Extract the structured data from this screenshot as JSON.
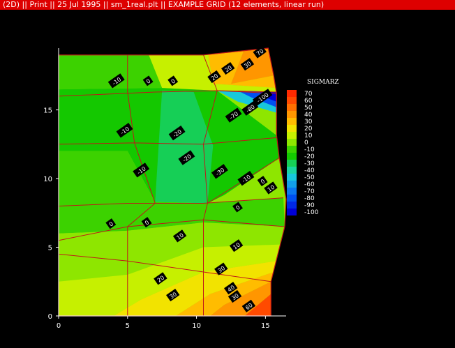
{
  "window": {
    "title": "(2D) || Print || 25 Jul 1995 || sm_1real.plt || EXAMPLE GRID (12 elements, linear run)"
  },
  "chart_data": {
    "type": "contour",
    "field": "SIGMARZ",
    "xlim": [
      0,
      16.5
    ],
    "ylim": [
      0,
      19.5
    ],
    "x_ticks": [
      "0",
      "5",
      "10",
      "15"
    ],
    "y_ticks": [
      "0",
      "5",
      "10",
      "15"
    ],
    "legend": {
      "title": "SIGMARZ",
      "levels": [
        70,
        60,
        50,
        40,
        30,
        20,
        10,
        0,
        -10,
        -20,
        -30,
        -40,
        -50,
        -60,
        -70,
        -80,
        -90,
        -100
      ],
      "colors": [
        "#ff2a00",
        "#ff4a00",
        "#ff7000",
        "#ff9600",
        "#ffbc00",
        "#f2e300",
        "#c6f000",
        "#8ee600",
        "#3cd200",
        "#14c800",
        "#16cf56",
        "#1ad6a0",
        "#18c8dc",
        "#12a0e8",
        "#0a78f0",
        "#0050f0",
        "#0028e8",
        "#0000d8"
      ]
    },
    "domain_outline": [
      [
        0,
        0
      ],
      [
        15.4,
        0
      ],
      [
        15.4,
        2.5
      ],
      [
        16.4,
        6.5
      ],
      [
        16.5,
        8.5
      ],
      [
        16.0,
        11.5
      ],
      [
        15.8,
        13.2
      ],
      [
        15.8,
        16.2
      ],
      [
        15.6,
        17.5
      ],
      [
        15.2,
        19.5
      ],
      [
        10.5,
        19.0
      ],
      [
        0,
        19.0
      ]
    ],
    "mesh_lines": [
      [
        [
          0,
          19.0
        ],
        [
          10.5,
          19.0
        ],
        [
          15.2,
          19.5
        ]
      ],
      [
        [
          0,
          16.0
        ],
        [
          7,
          16.3
        ],
        [
          11.5,
          16.4
        ],
        [
          15.8,
          16.3
        ]
      ],
      [
        [
          0,
          12.5
        ],
        [
          5.5,
          12.6
        ],
        [
          10.5,
          12.5
        ],
        [
          16.0,
          13.0
        ]
      ],
      [
        [
          0,
          8.0
        ],
        [
          5,
          8.2
        ],
        [
          10.5,
          8.2
        ],
        [
          16.3,
          8.6
        ]
      ],
      [
        [
          0,
          5.5
        ],
        [
          5,
          6.5
        ],
        [
          10.5,
          7.0
        ],
        [
          16.4,
          6.5
        ]
      ],
      [
        [
          0,
          4.5
        ],
        [
          5,
          4.0
        ],
        [
          10.5,
          3.2
        ],
        [
          15.4,
          2.5
        ]
      ],
      [
        [
          5,
          19.0
        ],
        [
          5,
          16.3
        ],
        [
          5.5,
          12.6
        ],
        [
          7,
          8.2
        ],
        [
          5,
          6.5
        ],
        [
          5,
          4.0
        ],
        [
          5,
          0
        ]
      ],
      [
        [
          10.5,
          19.0
        ],
        [
          11.5,
          16.4
        ],
        [
          10.5,
          12.5
        ],
        [
          10.8,
          8.2
        ],
        [
          10.5,
          7.0
        ],
        [
          10.5,
          3.2
        ],
        [
          10.5,
          0
        ]
      ],
      [
        [
          11.5,
          16.4
        ],
        [
          15.8,
          16.2
        ]
      ],
      [
        [
          10.8,
          8.2
        ],
        [
          16.0,
          11.5
        ]
      ]
    ],
    "zones": [
      {
        "level": 40,
        "polygon": [
          [
            13.5,
            19.5
          ],
          [
            15.2,
            19.5
          ],
          [
            15.6,
            17.5
          ],
          [
            12.5,
            16.9
          ]
        ]
      },
      {
        "level": 30,
        "polygon": [
          [
            10.8,
            19.3
          ],
          [
            13.5,
            19.5
          ],
          [
            12.5,
            16.9
          ],
          [
            15.6,
            17.5
          ],
          [
            15.8,
            16.6
          ],
          [
            11.2,
            16.9
          ]
        ]
      },
      {
        "level": 10,
        "polygon": [
          [
            6.5,
            19.1
          ],
          [
            10.8,
            19.3
          ],
          [
            11.2,
            16.9
          ],
          [
            15.8,
            16.6
          ],
          [
            15.8,
            16.2
          ],
          [
            7.5,
            16.6
          ]
        ]
      },
      {
        "level": -50,
        "polygon": [
          [
            11.5,
            16.4
          ],
          [
            15.8,
            16.3
          ],
          [
            15.8,
            14.8
          ],
          [
            13.0,
            15.6
          ]
        ]
      },
      {
        "level": -80,
        "polygon": [
          [
            13.0,
            16.4
          ],
          [
            15.8,
            16.3
          ],
          [
            15.8,
            15.2
          ],
          [
            14.0,
            15.9
          ]
        ]
      },
      {
        "level": -100,
        "polygon": [
          [
            14.6,
            16.3
          ],
          [
            15.8,
            16.3
          ],
          [
            15.8,
            15.6
          ],
          [
            15.0,
            15.9
          ]
        ]
      },
      {
        "level": -10,
        "polygon": [
          [
            0,
            19.0
          ],
          [
            6.5,
            19.1
          ],
          [
            7.5,
            16.6
          ],
          [
            0,
            16.5
          ]
        ]
      },
      {
        "level": -20,
        "polygon": [
          [
            0,
            16.5
          ],
          [
            7.5,
            16.6
          ],
          [
            11.5,
            16.4
          ],
          [
            16.0,
            13.0
          ],
          [
            16.0,
            11.5
          ],
          [
            12.0,
            8.8
          ],
          [
            7.0,
            8.3
          ],
          [
            5.0,
            12.0
          ],
          [
            0,
            12.0
          ]
        ]
      },
      {
        "level": -30,
        "polygon": [
          [
            7.0,
            8.3
          ],
          [
            10.8,
            8.2
          ],
          [
            12.0,
            8.8
          ],
          [
            11.2,
            12.4
          ],
          [
            9.8,
            16.3
          ],
          [
            7.5,
            16.4
          ]
        ]
      },
      {
        "level": -20,
        "polygon": [
          [
            10.8,
            8.2
          ],
          [
            12.0,
            8.8
          ],
          [
            16.0,
            11.5
          ],
          [
            16.0,
            13.0
          ],
          [
            12.5,
            12.6
          ],
          [
            11.2,
            12.4
          ]
        ]
      },
      {
        "level": -10,
        "polygon": [
          [
            0,
            12.0
          ],
          [
            5.0,
            12.0
          ],
          [
            7.0,
            8.3
          ],
          [
            10.8,
            8.2
          ],
          [
            16.3,
            8.6
          ],
          [
            16.4,
            6.5
          ],
          [
            10.5,
            6.8
          ],
          [
            5.0,
            6.2
          ],
          [
            0,
            6.0
          ]
        ]
      },
      {
        "level": 0,
        "polygon": [
          [
            0,
            6.0
          ],
          [
            5.0,
            6.2
          ],
          [
            10.5,
            6.8
          ],
          [
            16.4,
            6.5
          ],
          [
            16.1,
            5.2
          ],
          [
            10.5,
            5.0
          ],
          [
            5.0,
            3.0
          ],
          [
            0,
            2.5
          ]
        ]
      },
      {
        "level": 10,
        "polygon": [
          [
            0,
            2.5
          ],
          [
            5.0,
            3.0
          ],
          [
            10.5,
            5.0
          ],
          [
            16.1,
            5.2
          ],
          [
            15.8,
            4.0
          ],
          [
            10.5,
            3.2
          ],
          [
            6.0,
            1.2
          ],
          [
            4.0,
            0
          ],
          [
            0,
            0
          ]
        ]
      },
      {
        "level": 20,
        "polygon": [
          [
            4.0,
            0
          ],
          [
            6.0,
            1.2
          ],
          [
            10.5,
            3.2
          ],
          [
            15.8,
            4.0
          ],
          [
            15.6,
            3.2
          ],
          [
            11.0,
            1.6
          ],
          [
            8.5,
            0
          ]
        ]
      },
      {
        "level": 30,
        "polygon": [
          [
            8.5,
            0
          ],
          [
            11.0,
            1.6
          ],
          [
            15.6,
            3.2
          ],
          [
            15.4,
            2.5
          ],
          [
            12.0,
            0.8
          ],
          [
            11.0,
            0
          ]
        ]
      },
      {
        "level": 40,
        "polygon": [
          [
            11.0,
            0
          ],
          [
            12.0,
            0.8
          ],
          [
            15.4,
            2.5
          ],
          [
            15.4,
            1.6
          ],
          [
            13.5,
            0
          ]
        ]
      },
      {
        "level": 60,
        "polygon": [
          [
            13.5,
            0
          ],
          [
            15.4,
            1.6
          ],
          [
            15.4,
            0
          ]
        ]
      }
    ],
    "contour_labels": [
      {
        "text": "70",
        "x": 14.6,
        "y": 19.2
      },
      {
        "text": "30",
        "x": 13.7,
        "y": 18.3
      },
      {
        "text": "20",
        "x": 12.3,
        "y": 18.0
      },
      {
        "text": "20",
        "x": 11.3,
        "y": 17.4
      },
      {
        "text": "-10",
        "x": 4.2,
        "y": 17.1
      },
      {
        "text": "0",
        "x": 6.5,
        "y": 17.1
      },
      {
        "text": "0",
        "x": 8.3,
        "y": 17.1
      },
      {
        "text": "-100",
        "x": 14.8,
        "y": 15.9
      },
      {
        "text": "-80",
        "x": 13.9,
        "y": 15.1
      },
      {
        "text": "-70",
        "x": 12.7,
        "y": 14.6
      },
      {
        "text": "-10",
        "x": 4.8,
        "y": 13.5
      },
      {
        "text": "-20",
        "x": 8.6,
        "y": 13.3
      },
      {
        "text": "-20",
        "x": 9.3,
        "y": 11.5
      },
      {
        "text": "-10",
        "x": 6.0,
        "y": 10.6
      },
      {
        "text": "-30",
        "x": 11.7,
        "y": 10.5
      },
      {
        "text": "-10",
        "x": 13.6,
        "y": 10.0
      },
      {
        "text": "0",
        "x": 14.8,
        "y": 9.8
      },
      {
        "text": "10",
        "x": 15.4,
        "y": 9.3
      },
      {
        "text": "0",
        "x": 13.0,
        "y": 7.9
      },
      {
        "text": "0",
        "x": 3.8,
        "y": 6.7
      },
      {
        "text": "0",
        "x": 6.4,
        "y": 6.8
      },
      {
        "text": "10",
        "x": 8.8,
        "y": 5.8
      },
      {
        "text": "10",
        "x": 12.9,
        "y": 5.1
      },
      {
        "text": "30",
        "x": 11.8,
        "y": 3.4
      },
      {
        "text": "20",
        "x": 7.4,
        "y": 2.7
      },
      {
        "text": "40",
        "x": 12.5,
        "y": 2.0
      },
      {
        "text": "30",
        "x": 8.3,
        "y": 1.5
      },
      {
        "text": "30",
        "x": 12.8,
        "y": 1.4
      },
      {
        "text": "60",
        "x": 13.8,
        "y": 0.7
      }
    ]
  }
}
